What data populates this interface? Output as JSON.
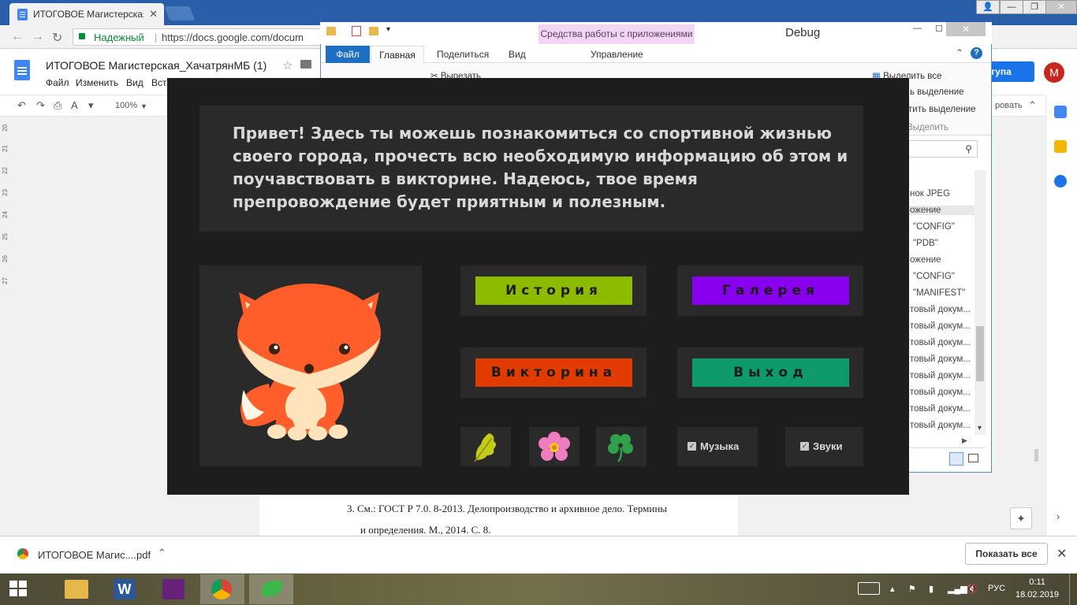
{
  "browser": {
    "tab_title": "ИТОГОВОЕ Магистерская",
    "secure_label": "Надежный",
    "url": "https://docs.google.com/docum"
  },
  "docs": {
    "title": "ИТОГОВОЕ Магистерская_ХачатрянМБ (1)",
    "menu": [
      "Файл",
      "Изменить",
      "Вид",
      "Вст"
    ],
    "zoom": "100%",
    "share_label": "тупа",
    "avatar_letter": "М",
    "ruler": [
      "20",
      "21",
      "22",
      "23",
      "24",
      "25",
      "26",
      "27"
    ],
    "footnote_line1": "3.  См.: ГОСТ Р 7.0. 8-2013. Делопроизводство и архивное дело. Термины",
    "footnote_line2": "и определения. М., 2014. С. 8.",
    "toolbar_right": "ровать"
  },
  "explorer": {
    "context_tab": "Средства работы с приложениями",
    "title": "Debug",
    "tabs": {
      "file": "Файл",
      "home": "Главная",
      "share": "Поделиться",
      "view": "Вид",
      "manage": "Управление"
    },
    "ribbon": {
      "cut": "Вырезать",
      "select_all": "Выделить все",
      "deselect": "ь выделение",
      "invert": "тить выделение",
      "group": "Выделить"
    },
    "list": [
      "нок JPEG",
      "ожение",
      "\"CONFIG\"",
      "\"PDB\"",
      "ожение",
      "\"CONFIG\"",
      "\"MANIFEST\"",
      "товый докум...",
      "товый докум...",
      "товый докум...",
      "товый докум...",
      "товый докум...",
      "товый докум...",
      "товый докум...",
      "товый докум..."
    ]
  },
  "game": {
    "intro": "Привет! Здесь ты можешь познакомиться со спортивной жизнью своего города, прочесть всю необходимую информацию об этом и поучавствовать в викторине. Надеюсь, твое время препровождение будет приятным и полезным.",
    "buttons": {
      "history": "История",
      "gallery": "Галерея",
      "quiz": "Викторина",
      "exit": "Выход"
    },
    "button_colors": {
      "history": "#8cbb00",
      "gallery": "#8800ee",
      "quiz": "#e23b00",
      "exit": "#0e9a6c"
    },
    "icons": [
      "oak-leaf-icon",
      "flower-icon",
      "clover-icon"
    ],
    "options": {
      "music": "Музыка",
      "sounds": "Звуки",
      "music_checked": true,
      "sounds_checked": true
    }
  },
  "downloads": {
    "file": "ИТОГОВОЕ Магис....pdf",
    "show_all": "Показать все"
  },
  "taskbar": {
    "lang": "РУС",
    "time": "0:11",
    "date": "18.02.2019"
  }
}
